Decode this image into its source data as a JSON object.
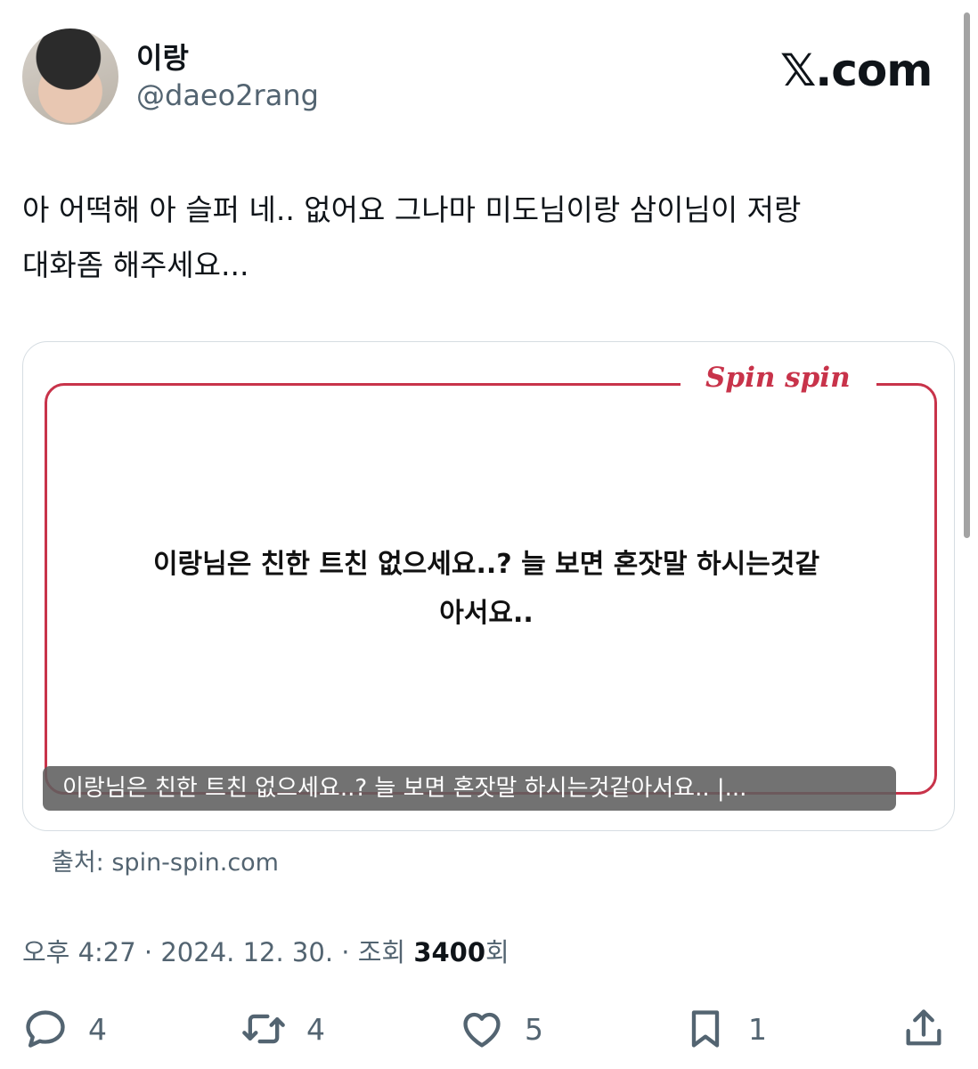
{
  "author": {
    "display_name": "이랑",
    "handle": "@daeo2rang"
  },
  "site_logo": "𝕏.com",
  "tweet": {
    "text_line1": "아 어떡해 아 슬퍼 네.. 없어요 그나마 미도님이랑 삼이님이 저랑",
    "text_line2": "대화좀 해주세요..."
  },
  "card": {
    "brand": "Spin spin",
    "question_line1": "이랑님은 친한 트친 없으세요..? 늘 보면 혼잣말 하시는것같",
    "question_line2": "아서요..",
    "caption": "이랑님은 친한 트친 없으세요..? 늘 보면 혼잣말 하시는것같아서요.. |...",
    "accent_color": "#c8334a"
  },
  "source": "출처: spin-spin.com",
  "meta": {
    "time": "오후 4:27",
    "sep1": "·",
    "date": "2024. 12. 30.",
    "sep2": "·",
    "views_label": "조회",
    "views_count": "3400",
    "views_suffix": "회"
  },
  "actions": {
    "reply_count": "4",
    "retweet_count": "4",
    "like_count": "5",
    "bookmark_count": "1",
    "icons": [
      "reply-icon",
      "retweet-icon",
      "heart-icon",
      "bookmark-icon",
      "share-icon"
    ]
  }
}
